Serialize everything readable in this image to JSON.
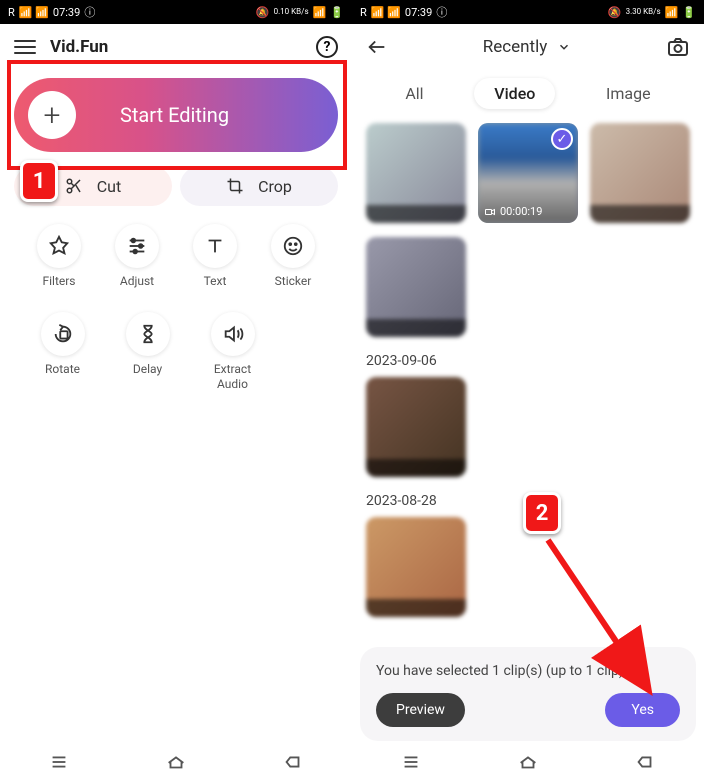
{
  "statusbar": {
    "carrier": "R",
    "time": "07:39",
    "net": "0.10 KB/s",
    "net2": "3.30 KB/s",
    "battery": "100"
  },
  "left": {
    "title": "Vid.Fun",
    "start_label": "Start Editing",
    "cut_label": "Cut",
    "crop_label": "Crop",
    "tools": {
      "filters": "Filters",
      "adjust": "Adjust",
      "text": "Text",
      "sticker": "Sticker",
      "rotate": "Rotate",
      "delay": "Delay",
      "extract": "Extract\nAudio"
    }
  },
  "right": {
    "dropdown": "Recently",
    "tabs": {
      "all": "All",
      "video": "Video",
      "image": "Image"
    },
    "selected_duration": "00:00:19",
    "sections": {
      "d1": "2023-09-06",
      "d2": "2023-08-28"
    },
    "sheet_text": "You have selected 1 clip(s) (up to 1 clip)",
    "preview": "Preview",
    "yes": "Yes"
  },
  "annotations": {
    "b1": "1",
    "b2": "2"
  }
}
